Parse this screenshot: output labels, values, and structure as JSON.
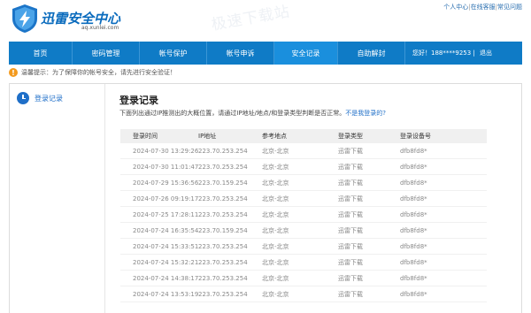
{
  "header": {
    "logo_title": "迅雷安全中心",
    "logo_sub": "aq.xunlei.com",
    "watermark": "极速下载站",
    "links": [
      "个人中心",
      "在线客服",
      "常见问题"
    ]
  },
  "nav": {
    "items": [
      "首页",
      "密码管理",
      "帐号保护",
      "帐号申诉",
      "安全记录",
      "自助解封"
    ],
    "active_index": 4,
    "user_greeting": "您好！188****9253",
    "logout": "退出"
  },
  "notice": {
    "text": "温馨提示：为了保障你的帐号安全，请先进行安全验证！"
  },
  "sidebar": {
    "items": [
      {
        "label": "登录记录",
        "icon": "clock-icon"
      }
    ]
  },
  "main": {
    "title": "登录记录",
    "desc": "下面列出通过IP推测出的大概位置，请通过IP地址/地点/和登录类型判断是否正常。",
    "desc_link": "不是我登录的?"
  },
  "table": {
    "headers": [
      "登录时间",
      "IP地址",
      "参考地点",
      "登录类型",
      "登录设备号"
    ],
    "rows": [
      [
        "2024-07-30 13:29:26",
        "223.70.253.254",
        "北京-北京",
        "迅雷下载",
        "dfb8fd8*"
      ],
      [
        "2024-07-30 11:01:47",
        "223.70.253.254",
        "北京-北京",
        "迅雷下载",
        "dfb8fd8*"
      ],
      [
        "2024-07-29 15:36:56",
        "223.70.159.254",
        "北京-北京",
        "迅雷下载",
        "dfb8fd8*"
      ],
      [
        "2024-07-26 09:19:17",
        "223.70.253.254",
        "北京-北京",
        "迅雷下载",
        "dfb8fd8*"
      ],
      [
        "2024-07-25 17:28:11",
        "223.70.253.254",
        "北京-北京",
        "迅雷下载",
        "dfb8fd8*"
      ],
      [
        "2024-07-24 16:35:54",
        "223.70.159.254",
        "北京-北京",
        "迅雷下载",
        "dfb8fd8*"
      ],
      [
        "2024-07-24 15:33:51",
        "223.70.253.254",
        "北京-北京",
        "迅雷下载",
        "dfb8fd8*"
      ],
      [
        "2024-07-24 15:32:21",
        "223.70.253.254",
        "北京-北京",
        "迅雷下载",
        "dfb8fd8*"
      ],
      [
        "2024-07-24 14:38:17",
        "223.70.253.254",
        "北京-北京",
        "迅雷下载",
        "dfb8fd8*"
      ],
      [
        "2024-07-24 13:53:19",
        "223.70.253.254",
        "北京-北京",
        "迅雷下载",
        "dfb8fd8*"
      ]
    ]
  },
  "colors": {
    "nav_bg": "#0f7bc6",
    "nav_active": "#1a8fdd",
    "link": "#1f6fc8",
    "warn": "#f39a1e"
  }
}
